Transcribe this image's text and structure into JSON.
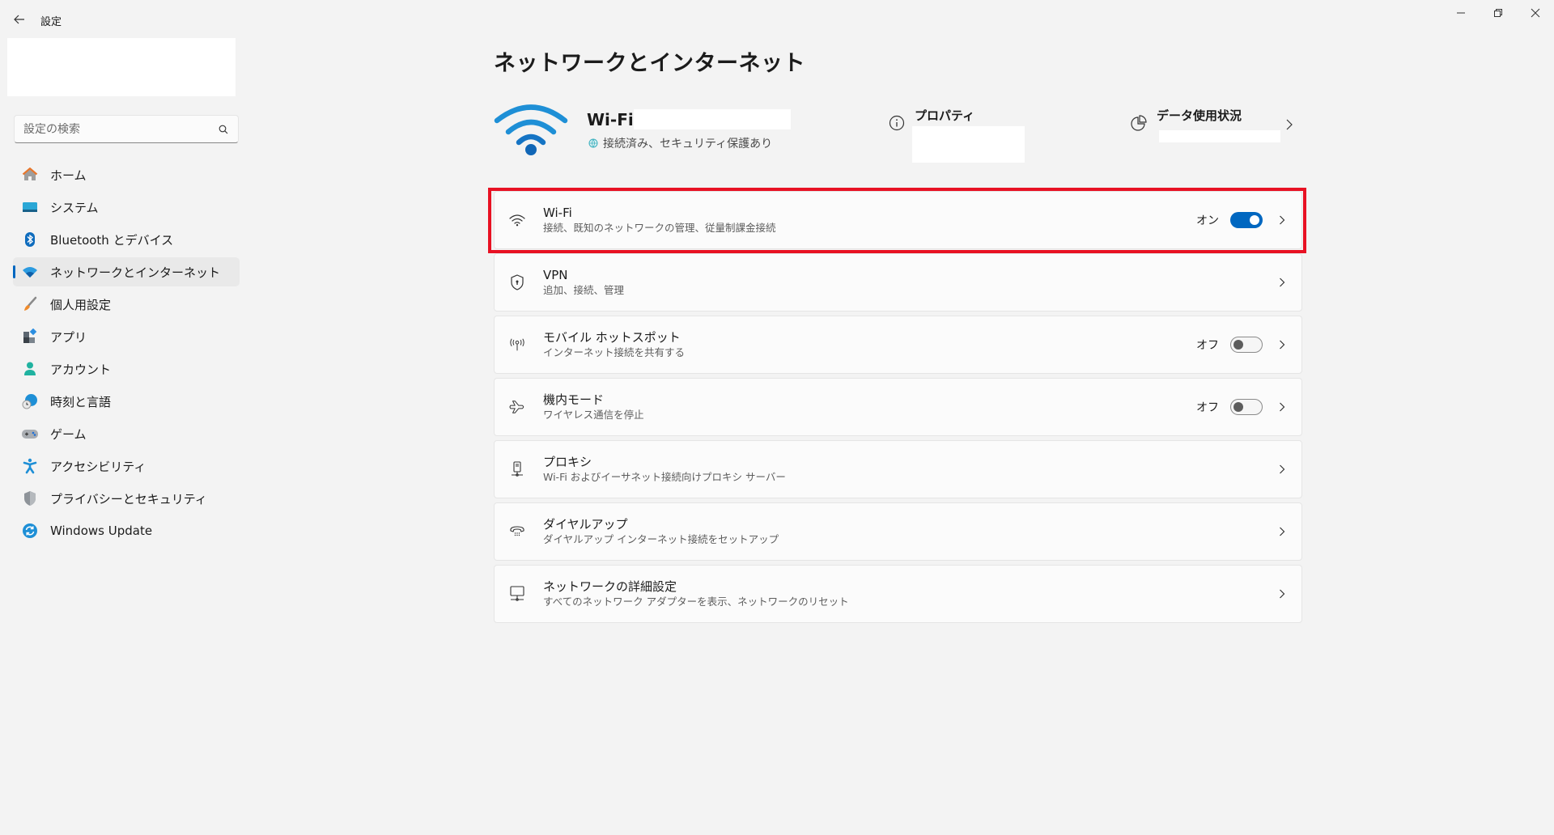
{
  "window": {
    "title": "設定",
    "controls": [
      "minimize",
      "restore",
      "close"
    ]
  },
  "sidebar": {
    "search_placeholder": "設定の検索",
    "items": [
      {
        "label": "ホーム",
        "icon": "home-icon",
        "selected": false
      },
      {
        "label": "システム",
        "icon": "system-icon",
        "selected": false
      },
      {
        "label": "Bluetooth とデバイス",
        "icon": "bluetooth-icon",
        "selected": false
      },
      {
        "label": "ネットワークとインターネット",
        "icon": "network-icon",
        "selected": true
      },
      {
        "label": "個人用設定",
        "icon": "personalization-brush-icon",
        "selected": false
      },
      {
        "label": "アプリ",
        "icon": "apps-icon",
        "selected": false
      },
      {
        "label": "アカウント",
        "icon": "account-icon",
        "selected": false
      },
      {
        "label": "時刻と言語",
        "icon": "time-language-icon",
        "selected": false
      },
      {
        "label": "ゲーム",
        "icon": "gamepad-icon",
        "selected": false
      },
      {
        "label": "アクセシビリティ",
        "icon": "accessibility-icon",
        "selected": false
      },
      {
        "label": "プライバシーとセキュリティ",
        "icon": "shield-icon",
        "selected": false
      },
      {
        "label": "Windows Update",
        "icon": "windows-update-icon",
        "selected": false
      }
    ]
  },
  "main": {
    "page_title": "ネットワークとインターネット",
    "hero": {
      "connection_type": "Wi-Fi",
      "status": "接続済み、セキュリティ保護あり"
    },
    "properties_label": "プロパティ",
    "data_usage_label": "データ使用状況",
    "settings": [
      {
        "title": "Wi-Fi",
        "subtitle": "接続、既知のネットワークの管理、従量制課金接続",
        "icon": "wifi-icon",
        "state_label": "オン",
        "toggle": "on",
        "highlighted": true
      },
      {
        "title": "VPN",
        "subtitle": "追加、接続、管理",
        "icon": "vpn-shield-icon"
      },
      {
        "title": "モバイル ホットスポット",
        "subtitle": "インターネット接続を共有する",
        "icon": "hotspot-icon",
        "state_label": "オフ",
        "toggle": "off"
      },
      {
        "title": "機内モード",
        "subtitle": "ワイヤレス通信を停止",
        "icon": "airplane-icon",
        "state_label": "オフ",
        "toggle": "off"
      },
      {
        "title": "プロキシ",
        "subtitle": "Wi-Fi およびイーサネット接続向けプロキシ サーバー",
        "icon": "proxy-icon"
      },
      {
        "title": "ダイヤルアップ",
        "subtitle": "ダイヤルアップ インターネット接続をセットアップ",
        "icon": "dialup-phone-icon"
      },
      {
        "title": "ネットワークの詳細設定",
        "subtitle": "すべてのネットワーク アダプターを表示、ネットワークのリセット",
        "icon": "advanced-network-icon"
      }
    ]
  },
  "colors": {
    "accent": "#0067c0",
    "highlight": "#e81123",
    "background": "#f3f3f3",
    "card": "#fbfbfb"
  }
}
